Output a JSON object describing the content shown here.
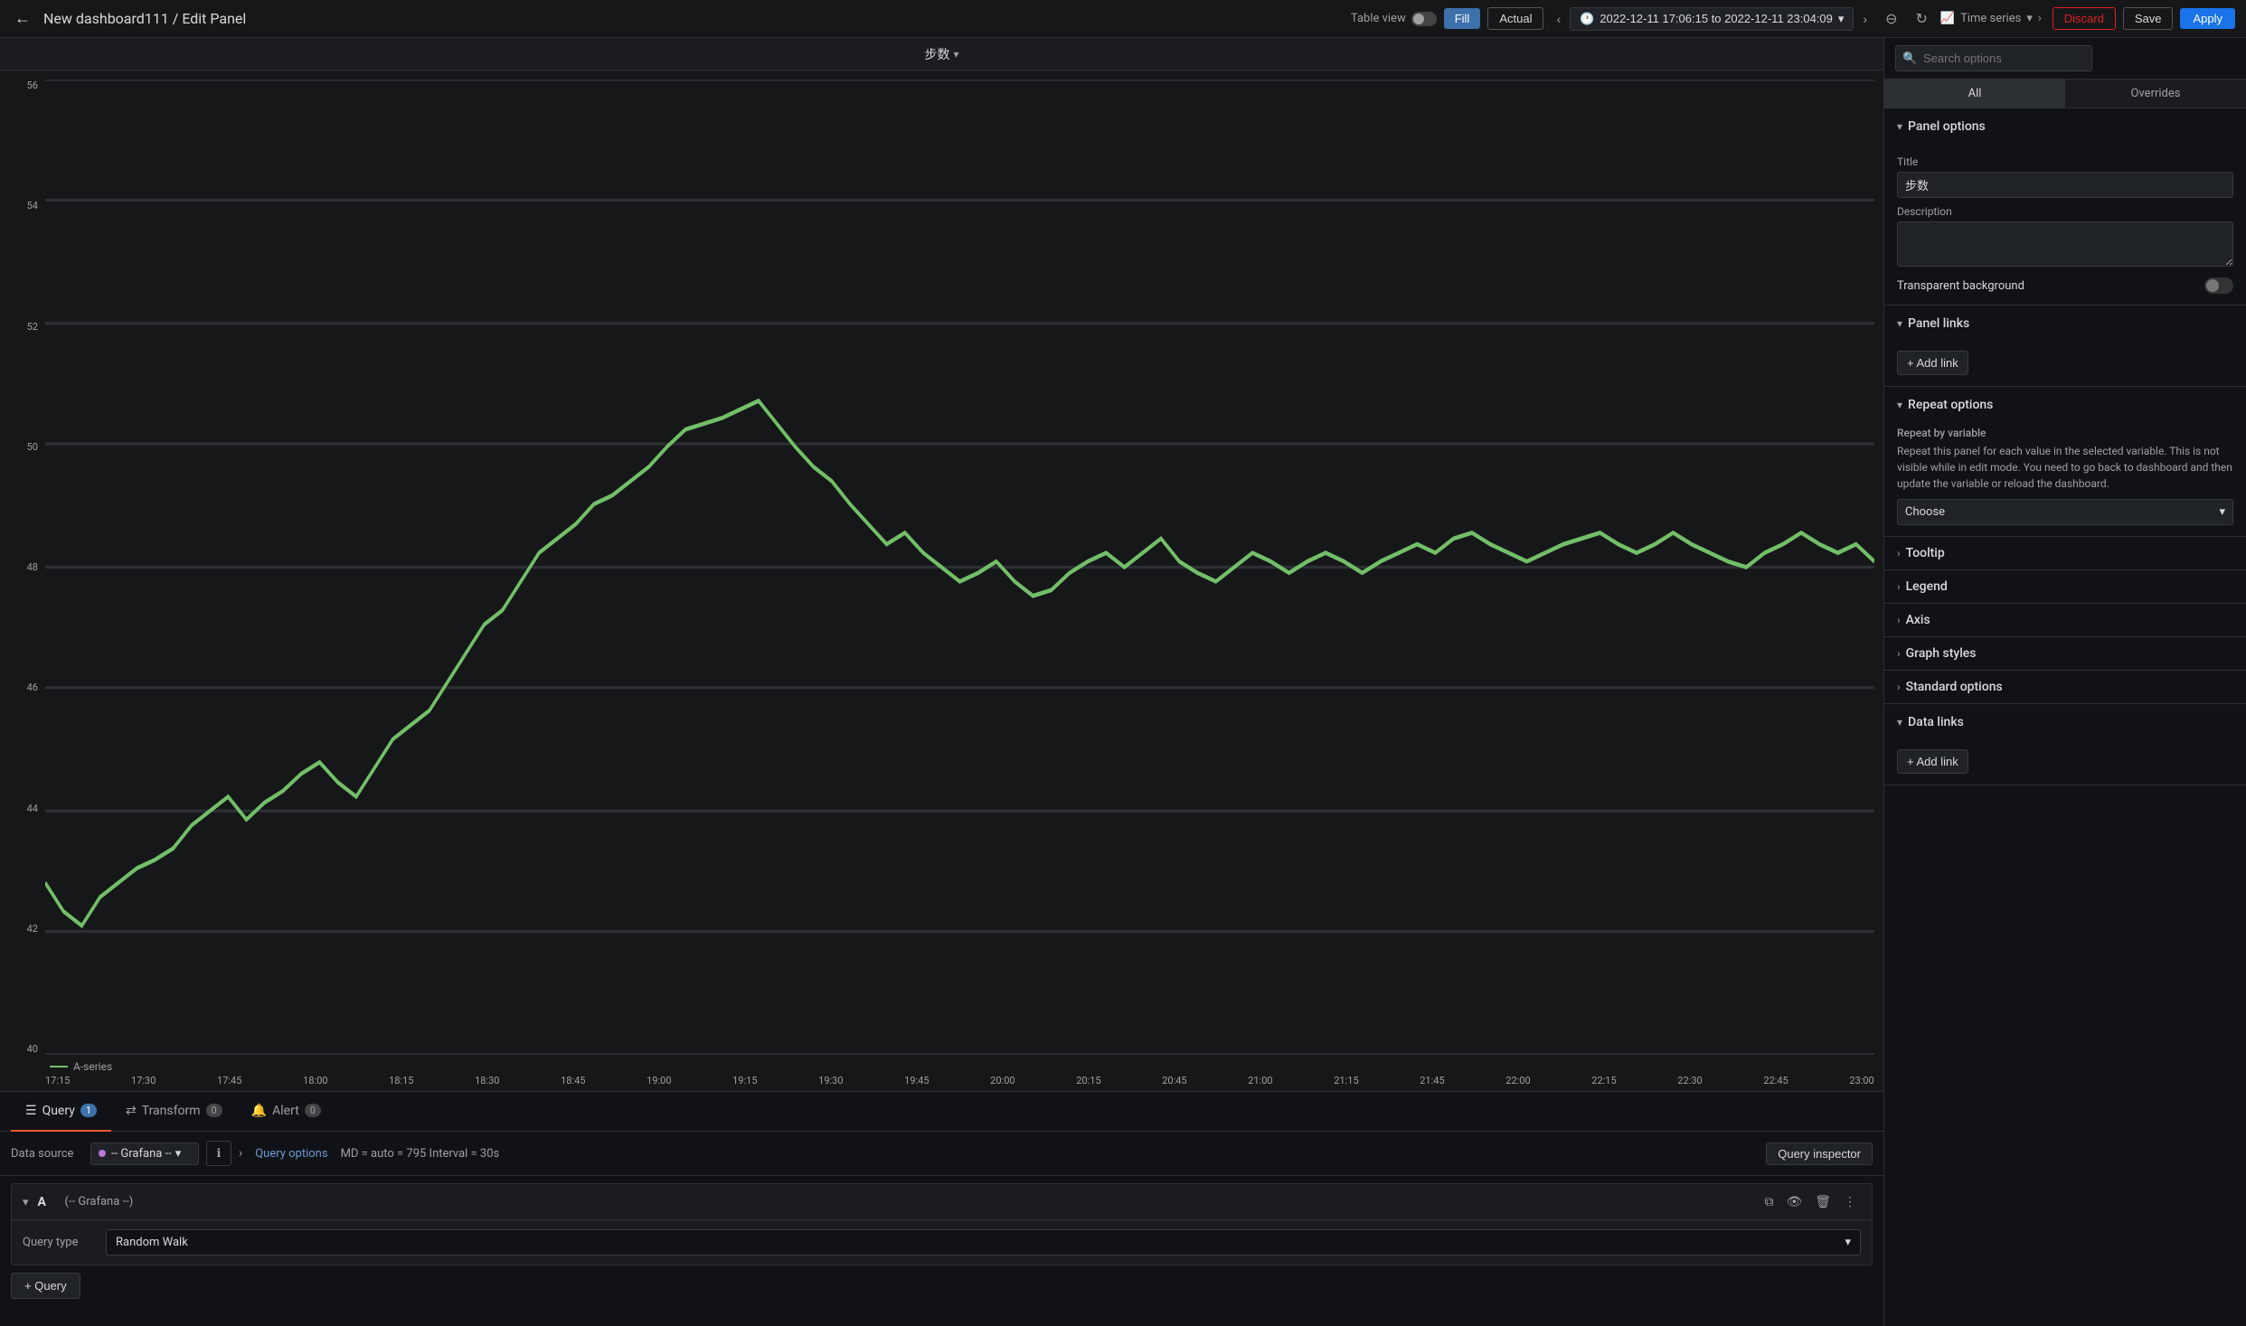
{
  "header": {
    "breadcrumb": "New dashboard111 / Edit Panel",
    "table_view_label": "Table view",
    "fill_label": "Fill",
    "actual_label": "Actual",
    "time_range": "2022-12-11 17:06:15 to 2022-12-11 23:04:09",
    "panel_type": "Time series",
    "discard_label": "Discard",
    "save_label": "Save",
    "apply_label": "Apply"
  },
  "chart": {
    "title": "步数",
    "y_labels": [
      "56",
      "54",
      "52",
      "50",
      "48",
      "46",
      "44",
      "42",
      "40"
    ],
    "x_labels": [
      "17:15",
      "17:30",
      "17:45",
      "18:00",
      "18:15",
      "18:30",
      "18:45",
      "19:00",
      "19:15",
      "19:30",
      "19:45",
      "20:00",
      "20:15",
      "20:45",
      "21:00",
      "21:15",
      "21:45",
      "22:00",
      "22:15",
      "22:30",
      "22:45",
      "23:00"
    ],
    "legend": "A-series"
  },
  "query_tabs": [
    {
      "id": "query",
      "icon": "☰",
      "label": "Query",
      "badge": "1",
      "active": true
    },
    {
      "id": "transform",
      "icon": "⇄",
      "label": "Transform",
      "badge": "0",
      "active": false
    },
    {
      "id": "alert",
      "icon": "🔔",
      "label": "Alert",
      "badge": "0",
      "active": false
    }
  ],
  "query_toolbar": {
    "ds_label": "Data source",
    "ds_name": "-- Grafana --",
    "query_options_label": "Query options",
    "query_meta": "MD = auto = 795   Interval = 30s",
    "query_inspector_label": "Query inspector"
  },
  "query_item": {
    "letter": "A",
    "ds_name": "(-- Grafana --)",
    "query_type_label": "Query type",
    "query_type_value": "Random Walk"
  },
  "add_query_label": "+ Query",
  "right_panel": {
    "search_placeholder": "Search options",
    "tabs": [
      "All",
      "Overrides"
    ],
    "active_tab": "All",
    "panel_options": {
      "title": "Panel options",
      "title_label": "Title",
      "title_value": "步数",
      "description_label": "Description",
      "description_value": "",
      "transparent_bg_label": "Transparent background"
    },
    "panel_links": {
      "title": "Panel links",
      "add_link_label": "+ Add link"
    },
    "repeat_options": {
      "title": "Repeat options",
      "repeat_by_label": "Repeat by variable",
      "repeat_desc": "Repeat this panel for each value in the selected variable. This is not visible while in edit mode. You need to go back to dashboard and then update the variable or reload the dashboard.",
      "choose_label": "Choose",
      "choose_value": "Choose"
    },
    "collapsed_sections": [
      {
        "id": "tooltip",
        "label": "Tooltip"
      },
      {
        "id": "legend",
        "label": "Legend"
      },
      {
        "id": "axis",
        "label": "Axis"
      },
      {
        "id": "graph_styles",
        "label": "Graph styles"
      },
      {
        "id": "standard_options",
        "label": "Standard options"
      },
      {
        "id": "data_links",
        "label": "Data links"
      },
      {
        "id": "add_link",
        "label": "+ Add link"
      }
    ]
  }
}
